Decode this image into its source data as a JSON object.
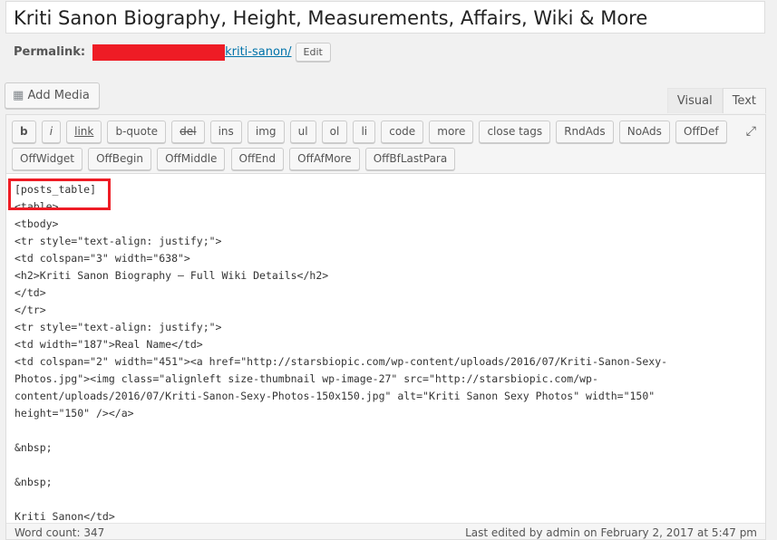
{
  "title": "Kriti Sanon Biography, Height, Measurements, Affairs, Wiki & More",
  "permalink": {
    "label": "Permalink:",
    "slug": "kriti-sanon/",
    "edit": "Edit"
  },
  "add_media": "Add Media",
  "tabs": [
    "Visual",
    "Text"
  ],
  "active_tab": "Text",
  "toolbar": [
    [
      "b",
      "i",
      "link",
      "b-quote",
      "del",
      "ins",
      "img",
      "ul",
      "ol",
      "li",
      "code",
      "more",
      "close tags",
      "RndAds",
      "NoAds",
      "OffDef"
    ],
    [
      "OffWidget",
      "OffBegin",
      "OffMiddle",
      "OffEnd",
      "OffAfMore",
      "OffBfLastPara"
    ]
  ],
  "content_lines": [
    "[posts_table]",
    "<table>",
    "<tbody>",
    "<tr style=\"text-align: justify;\">",
    "<td colspan=\"3\" width=\"638\">",
    "<h2>Kriti Sanon Biography – Full Wiki Details</h2>",
    "</td>",
    "</tr>",
    "<tr style=\"text-align: justify;\">",
    "<td width=\"187\">Real Name</td>",
    "<td colspan=\"2\" width=\"451\"><a href=\"http://starsbiopic.com/wp-content/uploads/2016/07/Kriti-Sanon-Sexy-",
    "Photos.jpg\"><img class=\"alignleft size-thumbnail wp-image-27\" src=\"http://starsbiopic.com/wp-",
    "content/uploads/2016/07/Kriti-Sanon-Sexy-Photos-150x150.jpg\" alt=\"Kriti Sanon Sexy Photos\" width=\"150\"",
    "height=\"150\" /></a>",
    "",
    "&nbsp;",
    "",
    "&nbsp;",
    "",
    "Kriti Sanon</td>"
  ],
  "footer": {
    "word_count": "Word count: 347",
    "last_edited": "Last edited by admin on February 2, 2017 at 5:47 pm"
  },
  "highlight_color": "#ee1c25"
}
